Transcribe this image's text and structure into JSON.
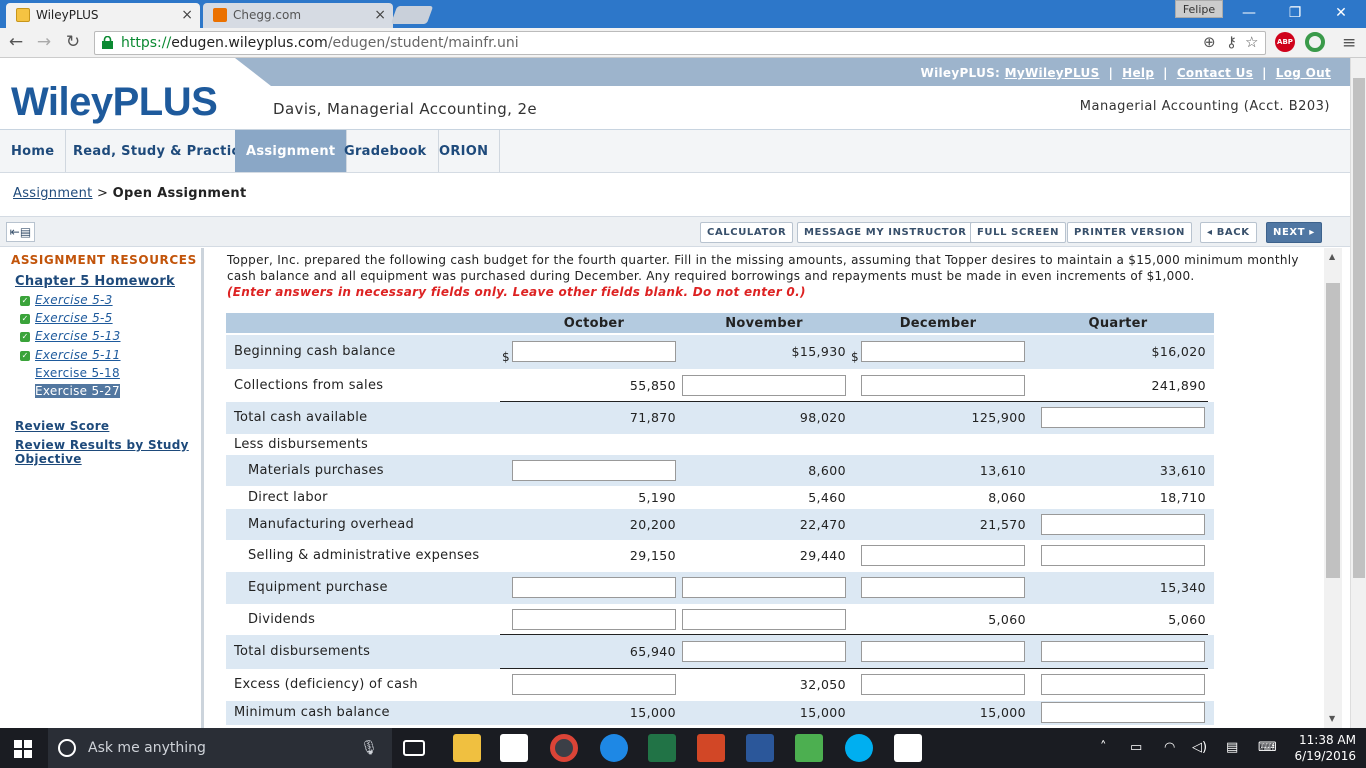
{
  "browser": {
    "tabs": [
      {
        "title": "WileyPLUS",
        "active": true
      },
      {
        "title": "Chegg.com",
        "active": false
      }
    ],
    "profile": "Felipe",
    "url_scheme": "https://",
    "url_domain": "edugen.wileyplus.com",
    "url_path": "/edugen/student/mainfr.uni"
  },
  "header": {
    "top_prefix": "WileyPLUS:",
    "top_links": [
      "MyWileyPLUS",
      "Help",
      "Contact Us",
      "Log Out"
    ],
    "logo": "WileyPLUS",
    "course": "Davis, Managerial Accounting, 2e",
    "class_name": "Managerial Accounting (Acct. B203)"
  },
  "nav": {
    "items": [
      "Home",
      "Read, Study & Practice",
      "Assignment",
      "Gradebook",
      "ORION"
    ],
    "selected": "Assignment"
  },
  "breadcrumb": {
    "link": "Assignment",
    "sep": ">",
    "current": "Open Assignment"
  },
  "toolbar": {
    "buttons": [
      "CALCULATOR",
      "MESSAGE MY INSTRUCTOR",
      "FULL SCREEN",
      "PRINTER VERSION"
    ],
    "back": "◂ BACK",
    "next": "NEXT ▸"
  },
  "sidebar": {
    "heading": "ASSIGNMENT RESOURCES",
    "chapter": "Chapter 5 Homework",
    "exercises": [
      {
        "label": "Exercise 5-3",
        "done": true
      },
      {
        "label": "Exercise 5-5",
        "done": true
      },
      {
        "label": "Exercise 5-13",
        "done": true
      },
      {
        "label": "Exercise 5-11",
        "done": true
      },
      {
        "label": "Exercise 5-18",
        "done": false
      },
      {
        "label": "Exercise 5-27",
        "done": false,
        "current": true
      }
    ],
    "review_score": "Review Score",
    "review_results": "Review Results by Study Objective"
  },
  "problem": {
    "text": "Topper, Inc. prepared the following cash budget for the fourth quarter. Fill in the missing amounts, assuming that Topper desires to maintain a $15,000 minimum monthly cash balance and all equipment was purchased during December. Any required borrowings and repayments must be made in even increments of $1,000.",
    "instruction": "(Enter answers in necessary fields only. Leave other fields blank. Do not enter 0.)"
  },
  "budget": {
    "columns": [
      "October",
      "November",
      "December",
      "Quarter"
    ],
    "rows": [
      {
        "label": "Beginning cash balance",
        "cells": [
          null,
          "$15,930",
          null,
          "$16,020"
        ],
        "indent": false
      },
      {
        "label": "Collections from sales",
        "cells": [
          "55,850",
          null,
          null,
          "241,890"
        ],
        "indent": false
      },
      {
        "label": "Total cash available",
        "cells": [
          "71,870",
          "98,020",
          "125,900",
          null
        ],
        "indent": false
      },
      {
        "label": "Less disbursements",
        "cells": [
          "",
          "",
          "",
          ""
        ],
        "indent": false,
        "header": true
      },
      {
        "label": "Materials purchases",
        "cells": [
          null,
          "8,600",
          "13,610",
          "33,610"
        ],
        "indent": true
      },
      {
        "label": "Direct labor",
        "cells": [
          "5,190",
          "5,460",
          "8,060",
          "18,710"
        ],
        "indent": true
      },
      {
        "label": "Manufacturing overhead",
        "cells": [
          "20,200",
          "22,470",
          "21,570",
          null
        ],
        "indent": true
      },
      {
        "label": "Selling & administrative expenses",
        "cells": [
          "29,150",
          "29,440",
          null,
          null
        ],
        "indent": true
      },
      {
        "label": "Equipment purchase",
        "cells": [
          null,
          null,
          null,
          "15,340"
        ],
        "indent": true
      },
      {
        "label": "Dividends",
        "cells": [
          null,
          null,
          "5,060",
          "5,060"
        ],
        "indent": true
      },
      {
        "label": "Total disbursements",
        "cells": [
          "65,940",
          null,
          null,
          null
        ],
        "indent": false
      },
      {
        "label": "Excess (deficiency) of cash",
        "cells": [
          null,
          "32,050",
          null,
          null
        ],
        "indent": false
      },
      {
        "label": "Minimum cash balance",
        "cells": [
          "15,000",
          "15,000",
          "15,000",
          null
        ],
        "indent": false
      }
    ]
  },
  "taskbar": {
    "search": "Ask me anything",
    "time": "11:38 AM",
    "date": "6/19/2016"
  }
}
